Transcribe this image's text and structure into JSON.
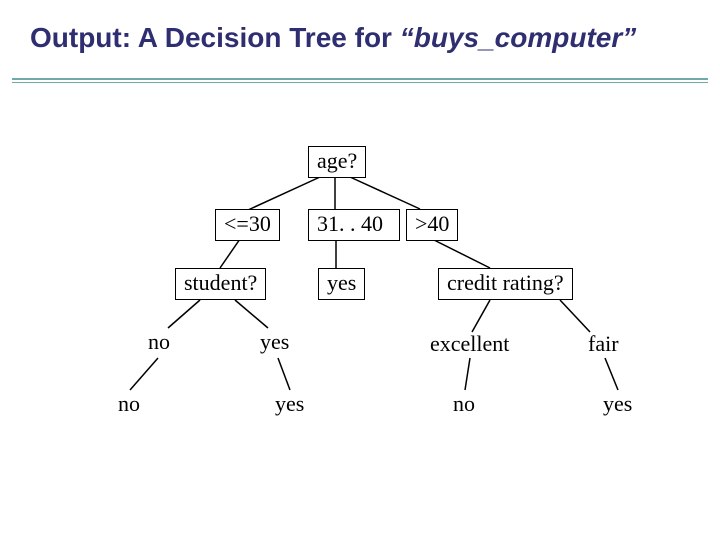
{
  "title": {
    "prefix": "Output: A Decision Tree for ",
    "quoted": "“buys_computer”"
  },
  "tree": {
    "root": "age?",
    "branch_age_le30": "<=30",
    "branch_age_31_40": "31. . 40",
    "branch_age_gt40": ">40",
    "node_student": "student?",
    "leaf_mid_yes": "yes",
    "node_credit": "credit rating?",
    "branch_student_no": "no",
    "branch_student_yes": "yes",
    "branch_credit_excellent": "excellent",
    "branch_credit_fair": "fair",
    "leaf_student_no": "no",
    "leaf_student_yes": "yes",
    "leaf_credit_excellent": "no",
    "leaf_credit_fair": "yes"
  }
}
